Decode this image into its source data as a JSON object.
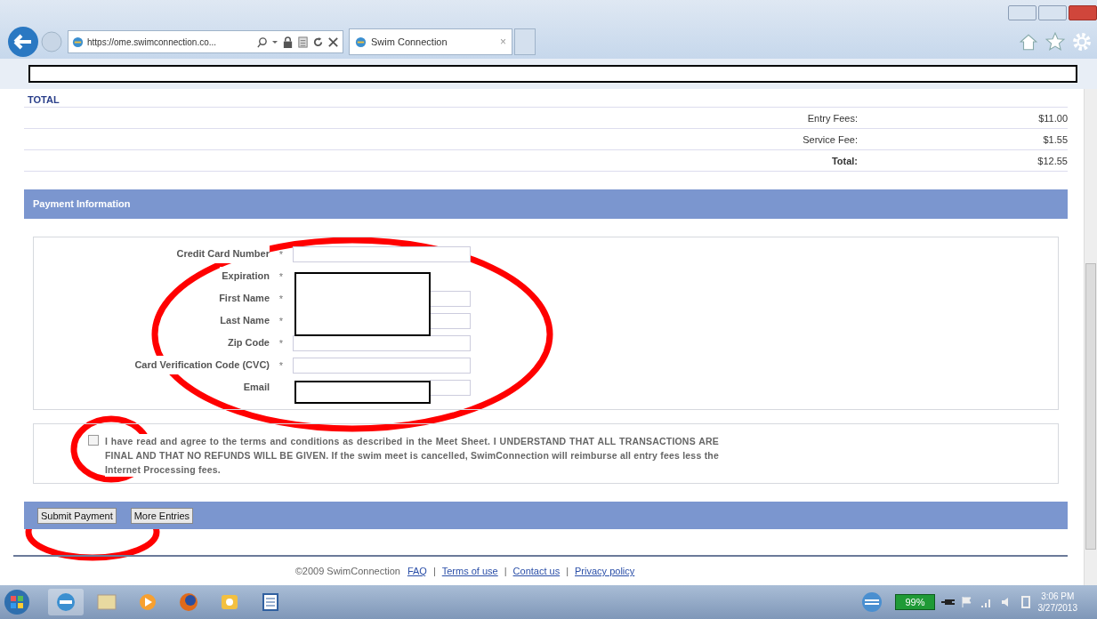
{
  "browser": {
    "address": "https://ome.swimconnection.co...",
    "tab": {
      "label": "Swim Connection",
      "close": "×",
      "selected": true
    }
  },
  "total": {
    "heading": "TOTAL",
    "rows": [
      {
        "label": "Entry Fees:",
        "value": "$11.00",
        "kind": "plain"
      },
      {
        "label": "Service Fee:",
        "value": "$1.55",
        "kind": "plain"
      },
      {
        "label": "Total:",
        "value": "$12.55",
        "kind": "sum"
      }
    ]
  },
  "payment": {
    "heading": "Payment Information",
    "fields": [
      {
        "label": "Credit Card Number",
        "marker": "*",
        "kind": "text"
      },
      {
        "label": "Expiration",
        "marker": "*",
        "kind": "covered"
      },
      {
        "label": "First Name",
        "marker": "*",
        "kind": "partly-covered"
      },
      {
        "label": "Last Name",
        "marker": "*",
        "kind": "partly-covered"
      },
      {
        "label": "Zip Code",
        "marker": "*",
        "kind": "text"
      },
      {
        "label": "Card Verification Code (CVC)",
        "marker": "*",
        "kind": "text"
      },
      {
        "label": "Email",
        "kind": "partly-covered"
      }
    ]
  },
  "terms": {
    "checked": false,
    "text": "I have read and agree to the terms and conditions as described in the Meet Sheet. **I UNDERSTAND THAT ALL TRANSACTIONS ARE FINAL AND THAT NO REFUNDS WILL BE GIVEN.** If the swim meet is cancelled, SwimConnection will reimburse all entry fees less the Internet Processing fees."
  },
  "buttons": [
    "Submit Payment",
    "More Entries"
  ],
  "footer": {
    "copyright": "©2009 SwimConnection",
    "links": [
      "FAQ",
      "Terms of use",
      "Contact us",
      "Privacy policy"
    ],
    "separator": "|"
  },
  "taskbar": {
    "battery": "99%",
    "time": "3:06 PM",
    "date": "3/27/2013"
  }
}
